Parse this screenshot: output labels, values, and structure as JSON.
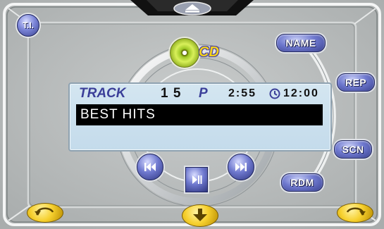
{
  "top_badge": {
    "icon": "eject-icon"
  },
  "ti_button": {
    "label": "T.I."
  },
  "source": {
    "label": "CD",
    "icon": "disc-icon"
  },
  "side_buttons": {
    "name": "NAME",
    "rep": "REP",
    "scn": "SCN",
    "rdm": "RDM"
  },
  "display": {
    "track_label": "TRACK",
    "track_number": "1 5",
    "mode": "P",
    "elapsed": "2:55",
    "clock_icon": "clock-icon",
    "clock": "12:00",
    "title": "BEST HITS"
  },
  "transport": {
    "prev_icon": "skip-back-icon",
    "play_icon": "play-pause-icon",
    "next_icon": "skip-forward-icon"
  },
  "bottom_buttons": {
    "left_icon": "rotate-left-icon",
    "center_icon": "down-arrow-icon",
    "right_icon": "rotate-right-icon"
  },
  "colors": {
    "frame": "#b7bbbb",
    "panel": "#c9def0",
    "accent": "#3b3f99",
    "gold": "#f6d02e"
  }
}
